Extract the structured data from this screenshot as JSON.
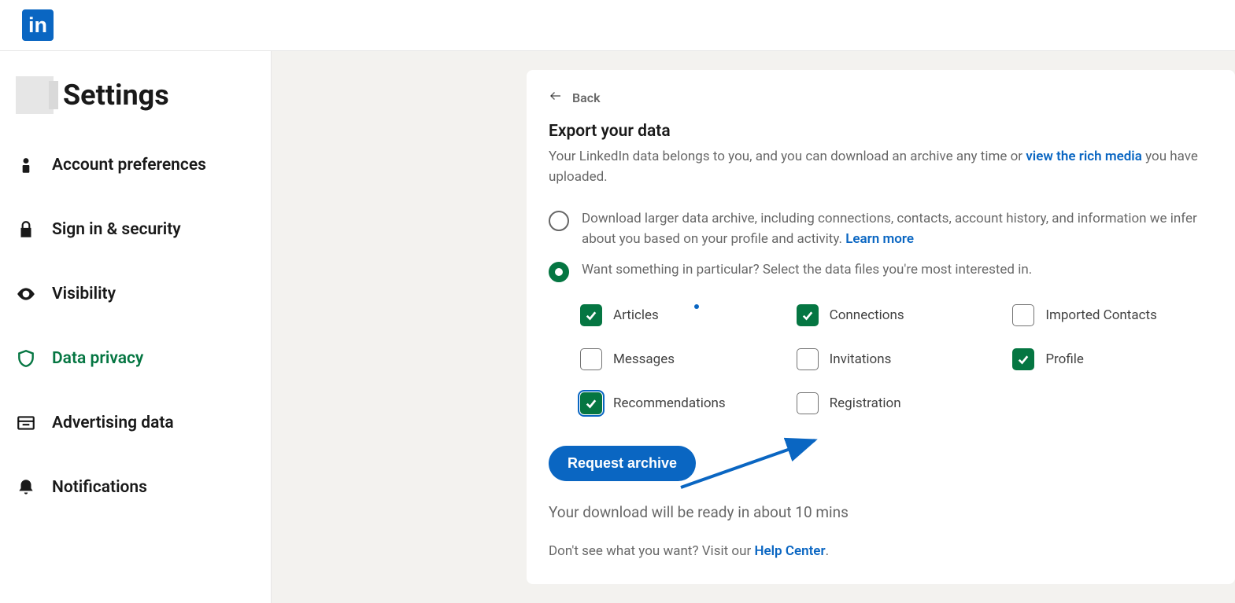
{
  "brand": "in",
  "page_title": "Settings",
  "sidebar": {
    "items": [
      {
        "id": "account-preferences",
        "label": "Account preferences"
      },
      {
        "id": "sign-in-security",
        "label": "Sign in & security"
      },
      {
        "id": "visibility",
        "label": "Visibility"
      },
      {
        "id": "data-privacy",
        "label": "Data privacy"
      },
      {
        "id": "advertising-data",
        "label": "Advertising data"
      },
      {
        "id": "notifications",
        "label": "Notifications"
      }
    ],
    "active": "data-privacy"
  },
  "back_label": "Back",
  "section": {
    "title": "Export your data",
    "desc_pre": "Your LinkedIn data belongs to you, and you can download an archive any time or ",
    "desc_link": "view the rich media",
    "desc_post": " you have uploaded."
  },
  "radios": {
    "opt1_pre": "Download larger data archive, including connections, contacts, account history, and information we infer about you based on your profile and activity. ",
    "opt1_link": "Learn more",
    "opt2": "Want something in particular? Select the data files you're most interested in.",
    "selected": "opt2"
  },
  "checkboxes": [
    {
      "id": "articles",
      "label": "Articles",
      "checked": true
    },
    {
      "id": "connections",
      "label": "Connections",
      "checked": true
    },
    {
      "id": "imported-contacts",
      "label": "Imported Contacts",
      "checked": false
    },
    {
      "id": "messages",
      "label": "Messages",
      "checked": false
    },
    {
      "id": "invitations",
      "label": "Invitations",
      "checked": false
    },
    {
      "id": "profile",
      "label": "Profile",
      "checked": true
    },
    {
      "id": "recommendations",
      "label": "Recommendations",
      "checked": true,
      "focused": true
    },
    {
      "id": "registration",
      "label": "Registration",
      "checked": false
    }
  ],
  "request_button": "Request archive",
  "download_note": "Your download will be ready in about 10 mins",
  "help_note_pre": "Don't see what you want? Visit our ",
  "help_note_link": "Help Center",
  "help_note_post": "."
}
